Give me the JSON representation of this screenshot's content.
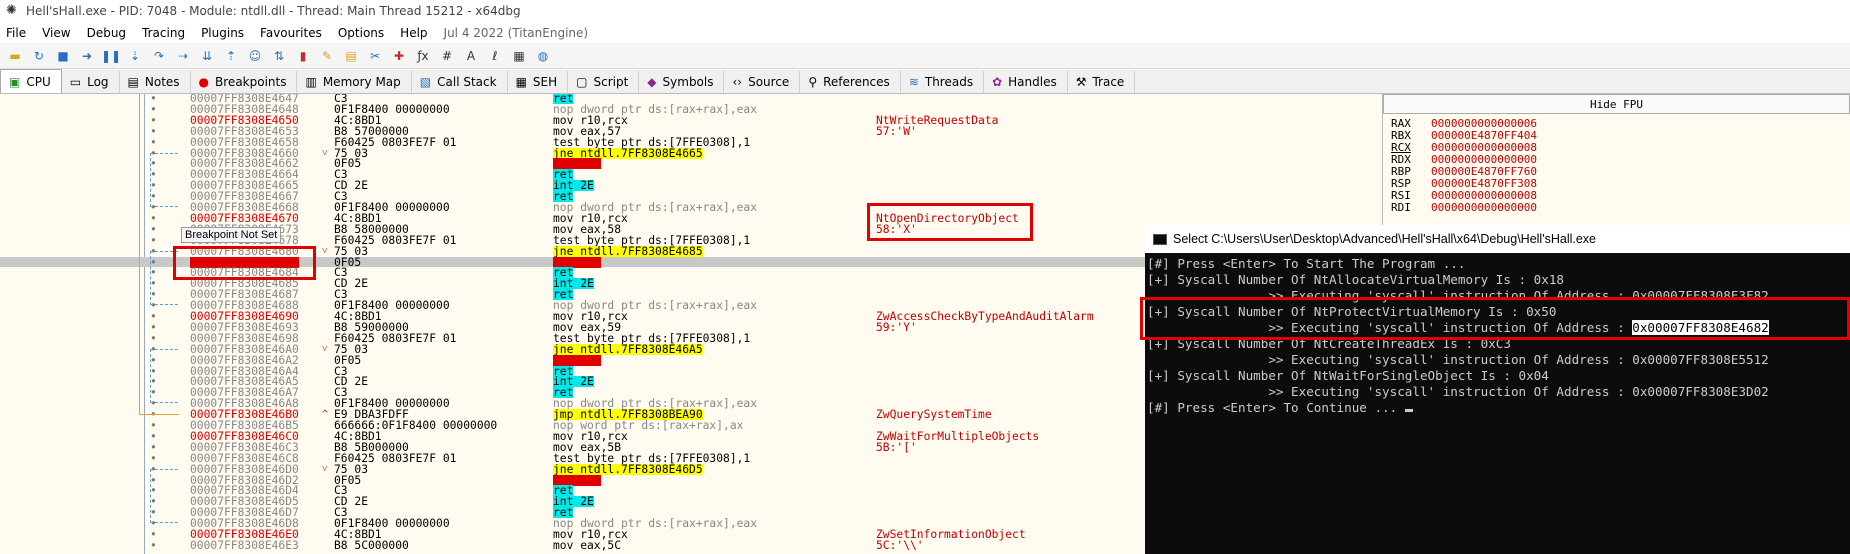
{
  "window": {
    "title": "Hell'sHall.exe - PID: 7048 - Module: ntdll.dll - Thread: Main Thread 15212 - x64dbg"
  },
  "menu": [
    "File",
    "View",
    "Debug",
    "Tracing",
    "Plugins",
    "Favourites",
    "Options",
    "Help"
  ],
  "menu_date": "Jul 4 2022 (TitanEngine)",
  "tabs": [
    {
      "label": "CPU",
      "icon": "cpu-icon"
    },
    {
      "label": "Log",
      "icon": "log-icon"
    },
    {
      "label": "Notes",
      "icon": "notes-icon"
    },
    {
      "label": "Breakpoints",
      "icon": "breakpoint-icon"
    },
    {
      "label": "Memory Map",
      "icon": "memory-map-icon"
    },
    {
      "label": "Call Stack",
      "icon": "call-stack-icon"
    },
    {
      "label": "SEH",
      "icon": "seh-icon"
    },
    {
      "label": "Script",
      "icon": "script-icon"
    },
    {
      "label": "Symbols",
      "icon": "symbols-icon"
    },
    {
      "label": "Source",
      "icon": "source-icon"
    },
    {
      "label": "References",
      "icon": "references-icon"
    },
    {
      "label": "Threads",
      "icon": "threads-icon"
    },
    {
      "label": "Handles",
      "icon": "handles-icon"
    },
    {
      "label": "Trace",
      "icon": "trace-icon"
    }
  ],
  "disasm": [
    {
      "addr": "00007FF8308E4647",
      "bytes": "C3",
      "ins": "ret",
      "cmt": "",
      "style": "cyan-ret"
    },
    {
      "addr": "00007FF8308E4648",
      "bytes": "0F1F8400 00000000",
      "ins": "nop dword ptr ds:[rax+rax],eax",
      "cmt": "",
      "style": "grey"
    },
    {
      "addr": "00007FF8308E4650",
      "bytes": "4C:8BD1",
      "ins": "mov r10,rcx",
      "cmt": "NtWriteRequestData",
      "addrred": true
    },
    {
      "addr": "00007FF8308E4653",
      "bytes": "B8 57000000",
      "ins": "mov eax,57",
      "cmt": "57:'W'"
    },
    {
      "addr": "00007FF8308E4658",
      "bytes": "F60425 0803FE7F 01",
      "ins": "test byte ptr ds:[7FFE0308],1",
      "cmt": ""
    },
    {
      "addr": "00007FF8308E4660",
      "bytes": "75 03",
      "ins": "jne ntdll.7FF8308E4665",
      "cmt": "",
      "style": "jne",
      "jmark": "v"
    },
    {
      "addr": "00007FF8308E4662",
      "bytes": "0F05",
      "ins": "syscall",
      "cmt": "",
      "style": "syscall"
    },
    {
      "addr": "00007FF8308E4664",
      "bytes": "C3",
      "ins": "ret",
      "cmt": "",
      "style": "cyan-ret"
    },
    {
      "addr": "00007FF8308E4665",
      "bytes": "CD 2E",
      "ins": "int 2E",
      "cmt": "",
      "style": "int"
    },
    {
      "addr": "00007FF8308E4667",
      "bytes": "C3",
      "ins": "ret",
      "cmt": "",
      "style": "cyan-ret"
    },
    {
      "addr": "00007FF8308E4668",
      "bytes": "0F1F8400 00000000",
      "ins": "nop dword ptr ds:[rax+rax],eax",
      "cmt": "",
      "style": "grey"
    },
    {
      "addr": "00007FF8308E4670",
      "bytes": "4C:8BD1",
      "ins": "mov r10,rcx",
      "cmt": "NtOpenDirectoryObject",
      "addrred": true
    },
    {
      "addr": "00007FF8308E4673",
      "bytes": "B8 58000000",
      "ins": "mov eax,58",
      "cmt": "58:'X'"
    },
    {
      "addr": "00007FF8308E4678",
      "bytes": "F60425 0803FE7F 01",
      "ins": "test byte ptr ds:[7FFE0308],1",
      "cmt": ""
    },
    {
      "addr": "00007FF8308E4680",
      "bytes": "75 03",
      "ins": "jne ntdll.7FF8308E4685",
      "cmt": "",
      "style": "jne",
      "jmark": "v"
    },
    {
      "addr": "00007FF8308E4682",
      "bytes": "0F05",
      "ins": "syscall",
      "cmt": "",
      "style": "syscall",
      "hl": true,
      "addrredbg": true
    },
    {
      "addr": "00007FF8308E4684",
      "bytes": "C3",
      "ins": "ret",
      "cmt": "",
      "style": "cyan-ret"
    },
    {
      "addr": "00007FF8308E4685",
      "bytes": "CD 2E",
      "ins": "int 2E",
      "cmt": "",
      "style": "int"
    },
    {
      "addr": "00007FF8308E4687",
      "bytes": "C3",
      "ins": "ret",
      "cmt": "",
      "style": "cyan-ret"
    },
    {
      "addr": "00007FF8308E4688",
      "bytes": "0F1F8400 00000000",
      "ins": "nop dword ptr ds:[rax+rax],eax",
      "cmt": "",
      "style": "grey"
    },
    {
      "addr": "00007FF8308E4690",
      "bytes": "4C:8BD1",
      "ins": "mov r10,rcx",
      "cmt": "ZwAccessCheckByTypeAndAuditAlarm",
      "addrred": true
    },
    {
      "addr": "00007FF8308E4693",
      "bytes": "B8 59000000",
      "ins": "mov eax,59",
      "cmt": "59:'Y'"
    },
    {
      "addr": "00007FF8308E4698",
      "bytes": "F60425 0803FE7F 01",
      "ins": "test byte ptr ds:[7FFE0308],1",
      "cmt": ""
    },
    {
      "addr": "00007FF8308E46A0",
      "bytes": "75 03",
      "ins": "jne ntdll.7FF8308E46A5",
      "cmt": "",
      "style": "jne",
      "jmark": "v"
    },
    {
      "addr": "00007FF8308E46A2",
      "bytes": "0F05",
      "ins": "syscall",
      "cmt": "",
      "style": "syscall"
    },
    {
      "addr": "00007FF8308E46A4",
      "bytes": "C3",
      "ins": "ret",
      "cmt": "",
      "style": "cyan-ret"
    },
    {
      "addr": "00007FF8308E46A5",
      "bytes": "CD 2E",
      "ins": "int 2E",
      "cmt": "",
      "style": "int"
    },
    {
      "addr": "00007FF8308E46A7",
      "bytes": "C3",
      "ins": "ret",
      "cmt": "",
      "style": "cyan-ret"
    },
    {
      "addr": "00007FF8308E46A8",
      "bytes": "0F1F8400 00000000",
      "ins": "nop dword ptr ds:[rax+rax],eax",
      "cmt": "",
      "style": "grey"
    },
    {
      "addr": "00007FF8308E46B0",
      "bytes": "E9 DBA3FDFF",
      "ins": "jmp ntdll.7FF8308BEA90",
      "cmt": "ZwQuerySystemTime",
      "style": "jmp",
      "addrred": true,
      "jmark": "^"
    },
    {
      "addr": "00007FF8308E46B5",
      "bytes": "666666:0F1F8400 00000000",
      "ins": "nop word ptr ds:[rax+rax],ax",
      "cmt": "",
      "style": "grey"
    },
    {
      "addr": "00007FF8308E46C0",
      "bytes": "4C:8BD1",
      "ins": "mov r10,rcx",
      "cmt": "ZwWaitForMultipleObjects",
      "addrred": true
    },
    {
      "addr": "00007FF8308E46C3",
      "bytes": "B8 5B000000",
      "ins": "mov eax,5B",
      "cmt": "5B:'['"
    },
    {
      "addr": "00007FF8308E46C8",
      "bytes": "F60425 0803FE7F 01",
      "ins": "test byte ptr ds:[7FFE0308],1",
      "cmt": ""
    },
    {
      "addr": "00007FF8308E46D0",
      "bytes": "75 03",
      "ins": "jne ntdll.7FF8308E46D5",
      "cmt": "",
      "style": "jne",
      "jmark": "v"
    },
    {
      "addr": "00007FF8308E46D2",
      "bytes": "0F05",
      "ins": "syscall",
      "cmt": "",
      "style": "syscall"
    },
    {
      "addr": "00007FF8308E46D4",
      "bytes": "C3",
      "ins": "ret",
      "cmt": "",
      "style": "cyan-ret"
    },
    {
      "addr": "00007FF8308E46D5",
      "bytes": "CD 2E",
      "ins": "int 2E",
      "cmt": "",
      "style": "int"
    },
    {
      "addr": "00007FF8308E46D7",
      "bytes": "C3",
      "ins": "ret",
      "cmt": "",
      "style": "cyan-ret"
    },
    {
      "addr": "00007FF8308E46D8",
      "bytes": "0F1F8400 00000000",
      "ins": "nop dword ptr ds:[rax+rax],eax",
      "cmt": "",
      "style": "grey"
    },
    {
      "addr": "00007FF8308E46E0",
      "bytes": "4C:8BD1",
      "ins": "mov r10,rcx",
      "cmt": "ZwSetInformationObject",
      "addrred": true
    },
    {
      "addr": "00007FF8308E46E3",
      "bytes": "B8 5C000000",
      "ins": "mov eax,5C",
      "cmt": "5C:'\\\\'"
    }
  ],
  "tooltip": "Breakpoint Not Set",
  "registers": {
    "hide_fpu": "Hide FPU",
    "list": [
      {
        "name": "RAX",
        "value": "0000000000000006"
      },
      {
        "name": "RBX",
        "value": "000000E4870FF404"
      },
      {
        "name": "RCX",
        "value": "0000000000000008"
      },
      {
        "name": "RDX",
        "value": "0000000000000000"
      },
      {
        "name": "RBP",
        "value": "000000E4870FF760"
      },
      {
        "name": "RSP",
        "value": "000000E4870FF308"
      },
      {
        "name": "RSI",
        "value": "0000000000000008"
      },
      {
        "name": "RDI",
        "value": "0000000000000000"
      }
    ]
  },
  "console": {
    "title": "Select C:\\Users\\User\\Desktop\\Advanced\\Hell'sHall\\x64\\Debug\\Hell'sHall.exe",
    "lines": [
      "[#] Press <Enter> To Start The Program ...",
      "[+] Syscall Number Of NtAllocateVirtualMemory Is : 0x18",
      "                >> Executing 'syscall' instruction Of Address : 0x00007FF8308E3F82",
      "[+] Syscall Number Of NtProtectVirtualMemory Is : 0x50",
      "                >> Executing 'syscall' instruction Of Address : ",
      "[+] Syscall Number Of NtCreateThreadEx Is : 0xC3",
      "                >> Executing 'syscall' instruction Of Address : 0x00007FF8308E5512",
      "[+] Syscall Number Of NtWaitForSingleObject Is : 0x04",
      "                >> Executing 'syscall' instruction Of Address : 0x00007FF8308E3D02",
      "[#] Press <Enter> To Continue ... "
    ],
    "selected_address": "0x00007FF8308E4682"
  }
}
